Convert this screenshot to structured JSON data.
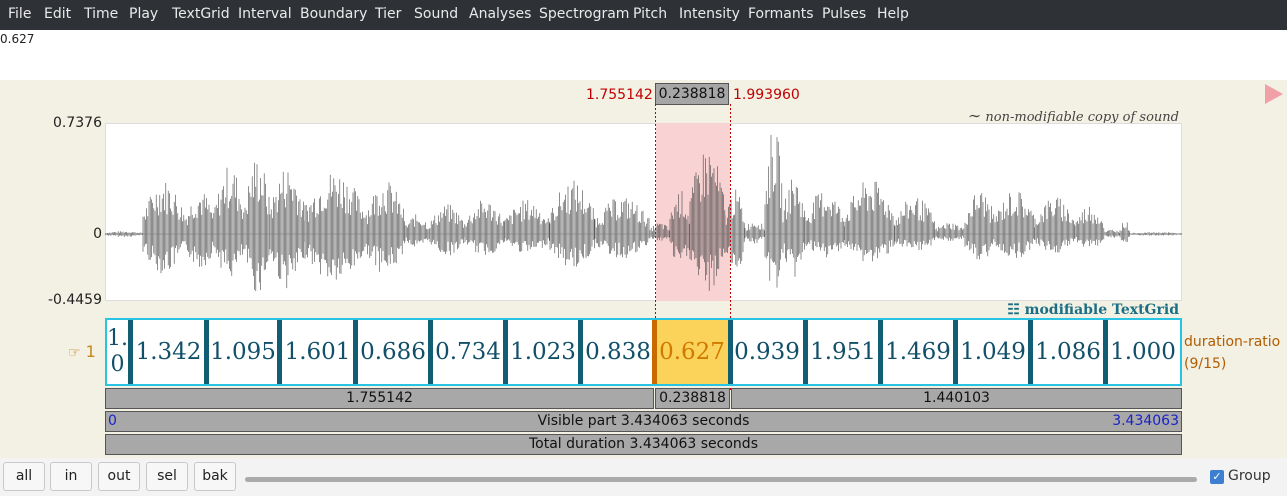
{
  "menu": [
    "File",
    "Edit",
    "Time",
    "Play",
    "TextGrid",
    "Interval",
    "Boundary",
    "Tier",
    "Sound",
    "Analyses",
    "Spectrogram",
    "Pitch",
    "Intensity",
    "Formants",
    "Pulses",
    "Help"
  ],
  "info_text": "0.627",
  "selection": {
    "start": "1.755142",
    "duration": "0.238818",
    "end": "1.993960"
  },
  "sound": {
    "caption": "non-modifiable copy of sound",
    "caption_icon": "tilde-icon",
    "y_max": "0.7376",
    "y_zero": "0",
    "y_min": "-0.4459"
  },
  "textgrid": {
    "caption": "modifiable TextGrid",
    "caption_icon": "grid-icon"
  },
  "tier": {
    "number": "1",
    "number_icon": "pointing-hand-icon",
    "name_line1": "duration-ratio",
    "name_line2": "(9/15)",
    "intervals": [
      "1.0",
      "1.342",
      "1.095",
      "1.601",
      "0.686",
      "0.734",
      "1.023",
      "0.838",
      "0.627",
      "0.939",
      "1.951",
      "1.469",
      "1.049",
      "1.086",
      "1.000"
    ],
    "selected_index": 8
  },
  "bars": {
    "before": "1.755142",
    "selected": "0.238818",
    "after": "1.440103",
    "visible_start": "0",
    "visible_label": "Visible part 3.434063 seconds",
    "visible_end": "3.434063",
    "total_label": "Total duration 3.434063 seconds"
  },
  "buttons": {
    "all": "all",
    "in": "in",
    "out": "out",
    "sel": "sel",
    "bak": "bak"
  },
  "group": {
    "label": "Group",
    "checked": true
  },
  "colors": {
    "selection_fill": "#f9d2d3",
    "selected_interval": "#fbd35a",
    "tier_border": "#29c3e3",
    "boundary": "#115e74"
  }
}
